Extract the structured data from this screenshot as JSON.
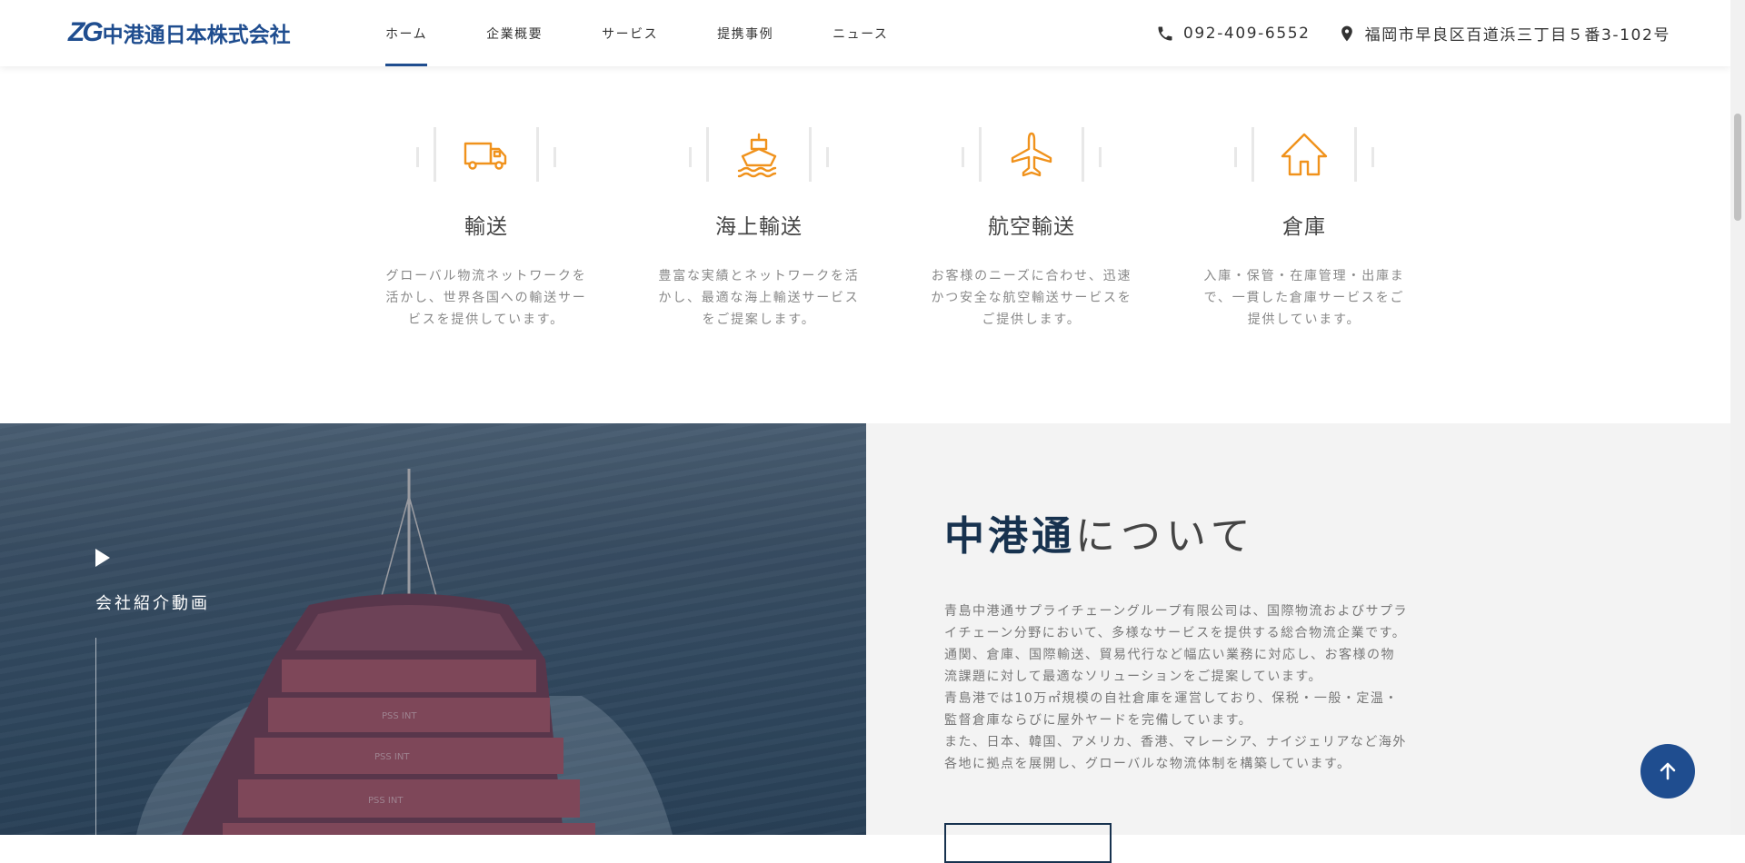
{
  "header": {
    "logo_mark": "ZG",
    "logo_text": "中港通日本株式会社",
    "nav": [
      {
        "label": "ホーム",
        "active": true
      },
      {
        "label": "企業概要",
        "active": false
      },
      {
        "label": "サービス",
        "active": false
      },
      {
        "label": "提携事例",
        "active": false
      },
      {
        "label": "ニュース",
        "active": false
      }
    ],
    "phone": "092-409-6552",
    "address": "福岡市早良区百道浜三丁目５番3-102号",
    "phone_icon": "phone-icon",
    "address_icon": "location-pin-icon"
  },
  "services": [
    {
      "icon": "truck-icon",
      "title": "輸送",
      "desc": "グローバル物流ネットワークを活かし、世界各国への輸送サービスを提供しています。"
    },
    {
      "icon": "ship-icon",
      "title": "海上輸送",
      "desc": "豊富な実績とネットワークを活かし、最適な海上輸送サービスをご提案します。"
    },
    {
      "icon": "airplane-icon",
      "title": "航空輸送",
      "desc": "お客様のニーズに合わせ、迅速かつ安全な航空輸送サービスをご提供します。"
    },
    {
      "icon": "house-icon",
      "title": "倉庫",
      "desc": "入庫・保管・在庫管理・出庫まで、一貫した倉庫サービスをご提供しています。"
    }
  ],
  "video": {
    "label": "会社紹介動画",
    "play_icon": "play-icon"
  },
  "about": {
    "title_strong": "中港通",
    "title_light": "について",
    "paragraphs": [
      "青島中港通サプライチェーングループ有限公司は、国際物流およびサプライチェーン分野において、多様なサービスを提供する総合物流企業です。",
      "通関、倉庫、国際輸送、貿易代行など幅広い業務に対応し、お客様の物流課題に対して最適なソリューションをご提案しています。",
      "青島港では10万㎡規模の自社倉庫を運営しており、保税・一般・定温・監督倉庫ならびに屋外ヤードを完備しています。",
      "また、日本、韓国、アメリカ、香港、マレーシア、ナイジェリアなど海外各地に拠点を展開し、グローバルな物流体制を構築しています。"
    ]
  },
  "colors": {
    "brand": "#1f4d8f",
    "accent_orange": "#f0921c",
    "title_navy": "#17324f"
  },
  "to_top_icon": "arrow-up-icon"
}
